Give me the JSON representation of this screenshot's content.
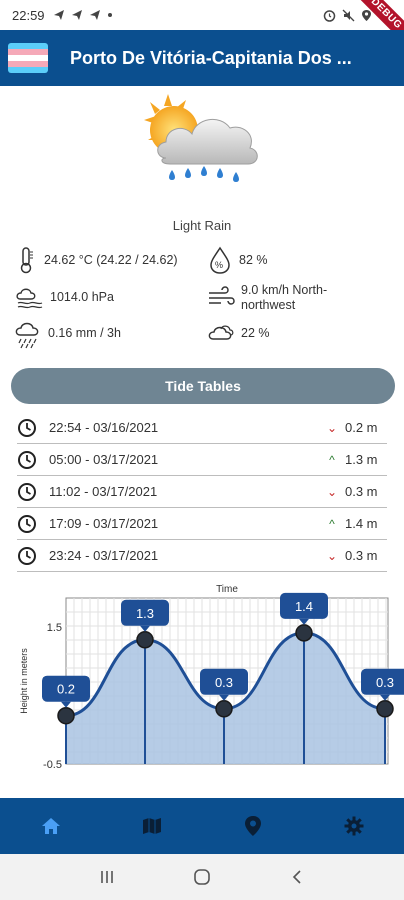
{
  "status_bar": {
    "time": "22:59",
    "debug_label": "DEBUG"
  },
  "app_bar": {
    "title": "Porto De Vitória-Capitania Dos ...",
    "flag_colors": [
      "#5bcefa",
      "#f5a9b8",
      "#ffffff",
      "#f5a9b8",
      "#5bcefa"
    ]
  },
  "weather": {
    "description": "Light Rain",
    "temperature": "24.62 °C (24.22 / 24.62)",
    "humidity": "82 %",
    "pressure": "1014.0 hPa",
    "wind": "9.0 km/h North-northwest",
    "precipitation": "0.16 mm  / 3h",
    "clouds": "22 %"
  },
  "tide_button_label": "Tide Tables",
  "tides": [
    {
      "datetime": "22:54 - 03/16/2021",
      "direction": "down",
      "arrow": "⌄",
      "height": "0.2 m"
    },
    {
      "datetime": "05:00 - 03/17/2021",
      "direction": "up",
      "arrow": "^",
      "height": "1.3 m"
    },
    {
      "datetime": "11:02 - 03/17/2021",
      "direction": "down",
      "arrow": "⌄",
      "height": "0.3 m"
    },
    {
      "datetime": "17:09 - 03/17/2021",
      "direction": "up",
      "arrow": "^",
      "height": "1.4 m"
    },
    {
      "datetime": "23:24 - 03/17/2021",
      "direction": "down",
      "arrow": "⌄",
      "height": "0.3 m"
    }
  ],
  "chart_data": {
    "type": "area",
    "title": "Time",
    "xlabel": "",
    "ylabel": "Height in meters",
    "ylim": [
      -0.5,
      1.5
    ],
    "yticks": [
      "1.5",
      "-0.5"
    ],
    "x": [
      "22:54",
      "05:00",
      "11:02",
      "17:09",
      "23:24"
    ],
    "values": [
      0.2,
      1.3,
      0.3,
      1.4,
      0.3
    ],
    "labels": [
      "0.2",
      "1.3",
      "0.3",
      "1.4",
      "0.3"
    ],
    "colors": {
      "line": "#1f4f96",
      "fill": "#a9c3e2",
      "badge": "#1f4f96"
    }
  }
}
